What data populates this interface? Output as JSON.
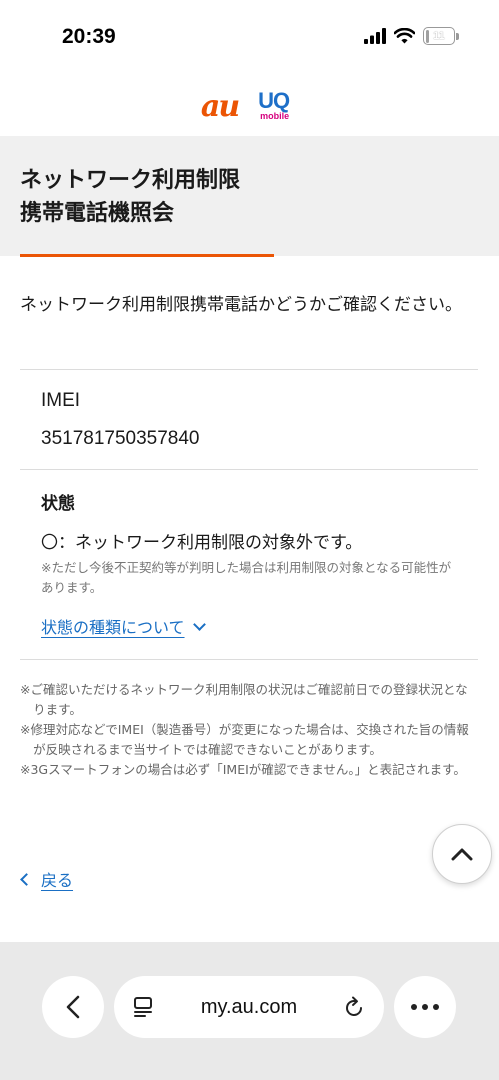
{
  "status_bar": {
    "time": "20:39",
    "battery": "11",
    "battery_level_percent": 11
  },
  "logo": {
    "au": "au",
    "uq": "UQ",
    "uq_sub": "mobile",
    "au_color": "#eb5505",
    "uq_color": "#1e6fc8",
    "uq_sub_color": "#d6007f"
  },
  "page": {
    "title_line1": "ネットワーク利用制限",
    "title_line2": "携帯電話機照会",
    "intro": "ネットワーク利用制限携帯電話かどうかご確認ください。"
  },
  "device": {
    "imei_label": "IMEI",
    "imei_value": "351781750357840"
  },
  "status": {
    "label": "状態",
    "result": "〇：ネットワーク利用制限の対象外です。",
    "note": "※ただし今後不正契約等が判明した場合は利用制限の対象となる可能性があります。",
    "link": "状態の種類について"
  },
  "notes": [
    "※ご確認いただけるネットワーク利用制限の状況はご確認前日での登録状況となります。",
    "※修理対応などでIMEI（製造番号）が変更になった場合は、交換された旨の情報が反映されるまで当サイトでは確認できないことがあります。",
    "※3Gスマートフォンの場合は必ず「IMEIが確認できません。」と表記されます。"
  ],
  "navigation": {
    "back": "戻る"
  },
  "browser": {
    "url": "my.au.com"
  },
  "colors": {
    "accent": "#eb5505",
    "link": "#1a6fc4",
    "title_band": "#f0f0f0",
    "toolbar": "#e9e9e9"
  },
  "icons": {
    "signal": "signal-bars-icon",
    "wifi": "wifi-icon",
    "battery": "battery-icon",
    "scroll_top": "chevron-up-icon",
    "back": "chevron-left-icon",
    "reader": "reader-mode-icon",
    "reload": "reload-icon",
    "more": "more-icon"
  }
}
